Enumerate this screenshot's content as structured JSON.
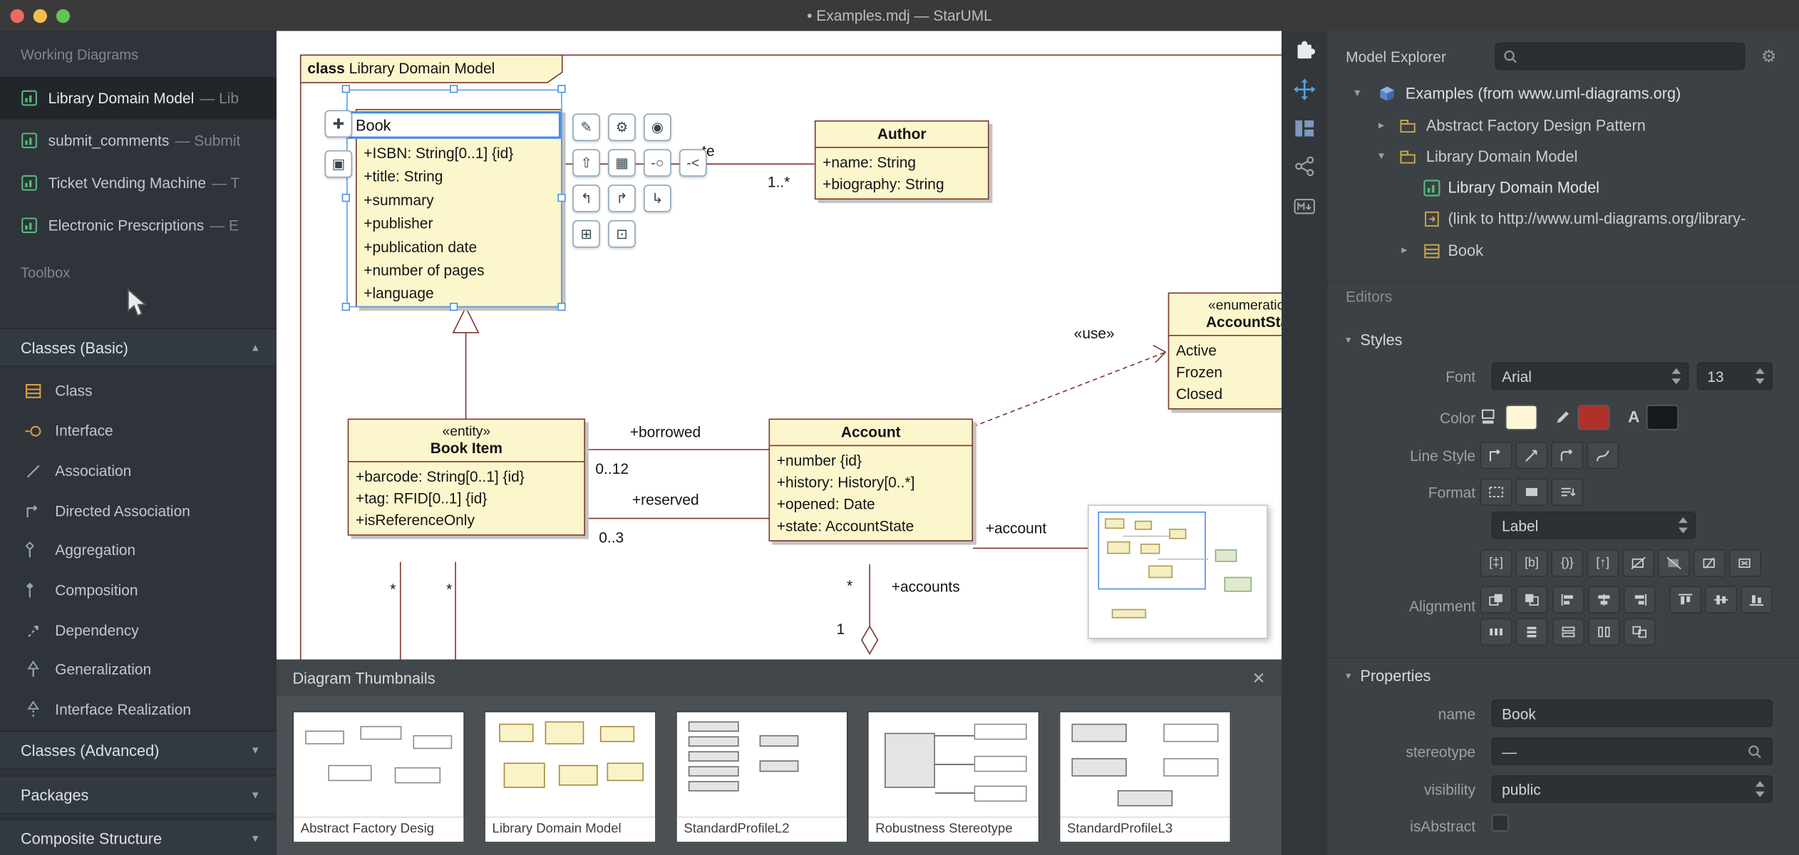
{
  "window": {
    "title": "• Examples.mdj — StarUML"
  },
  "colors": {
    "class_fill": "#FCF6CD",
    "line_maroon": "#7E352B",
    "selection_blue": "#4A90E2",
    "accent_blue": "#4FA3E3",
    "fill_swatch": "#FDF7D8",
    "line_swatch": "#B0312A",
    "font_swatch": "#17191B"
  },
  "sidebar": {
    "working_diagrams_header": "Working Diagrams",
    "diagrams": [
      {
        "name": "Library Domain Model",
        "suffix": "— Lib"
      },
      {
        "name": "submit_comments",
        "suffix": "— Submit"
      },
      {
        "name": "Ticket Vending Machine",
        "suffix": "— T"
      },
      {
        "name": "Electronic Prescriptions",
        "suffix": "— E"
      }
    ],
    "toolbox_header": "Toolbox",
    "sections": [
      {
        "label": "Classes (Basic)",
        "arrow": "▲"
      },
      {
        "label": "Classes (Advanced)",
        "arrow": "▼"
      },
      {
        "label": "Packages",
        "arrow": "▼"
      },
      {
        "label": "Composite Structure",
        "arrow": "▼"
      }
    ],
    "tools": [
      {
        "label": "Class"
      },
      {
        "label": "Interface"
      },
      {
        "label": "Association"
      },
      {
        "label": "Directed Association"
      },
      {
        "label": "Aggregation"
      },
      {
        "label": "Composition"
      },
      {
        "label": "Dependency"
      },
      {
        "label": "Generalization"
      },
      {
        "label": "Interface Realization"
      }
    ]
  },
  "diagram": {
    "frame": {
      "keyword": "class",
      "title": "Library Domain Model"
    },
    "book": {
      "name": "Book",
      "attributes": [
        "+ISBN: String[0..1] {id}",
        "+title: String",
        "+summary",
        "+publisher",
        "+publication date",
        "+number of pages",
        "+language"
      ]
    },
    "author": {
      "name": "Author",
      "attributes": [
        "+name: String",
        "+biography: String"
      ]
    },
    "book_item": {
      "stereotype": "«entity»",
      "name": "Book Item",
      "attributes": [
        "+barcode: String[0..1] {id}",
        "+tag: RFID[0..1] {id}",
        "+isReferenceOnly"
      ]
    },
    "account": {
      "name": "Account",
      "attributes": [
        "+number {id}",
        "+history: History[0..*]",
        "+opened: Date",
        "+state: AccountState"
      ]
    },
    "account_state": {
      "stereotype": "«enumeration»",
      "name": "AccountState",
      "literals": [
        "Active",
        "Frozen",
        "Closed"
      ]
    },
    "labels": {
      "partial": "te",
      "author_mult": "1..*",
      "borrowed": "+borrowed",
      "borrowed_mult": "0..12",
      "reserved": "+reserved",
      "reserved_mult": "0..3",
      "account_role": "+account",
      "accounts_role": "+accounts",
      "item_mult_1": "*",
      "item_mult_2": "*",
      "accounts_mult": "*",
      "account_mult_one": "1",
      "use": "«use»"
    }
  },
  "thumbnails": {
    "title": "Diagram Thumbnails",
    "close": "✕",
    "items": [
      {
        "caption": "Abstract Factory Desig"
      },
      {
        "caption": "Library Domain Model"
      },
      {
        "caption": "StandardProfileL2"
      },
      {
        "caption": "Robustness Stereotype"
      },
      {
        "caption": "StandardProfileL3"
      }
    ]
  },
  "right_toolbar": {
    "icons": [
      "extensions",
      "move",
      "layout",
      "share",
      "markdown"
    ]
  },
  "explorer": {
    "title": "Model Explorer",
    "tree": [
      {
        "label": "Examples (from www.uml-diagrams.org)",
        "arrow": "▾",
        "icon": "model"
      },
      {
        "label": "Abstract Factory Design Pattern",
        "arrow": "▸",
        "icon": "package"
      },
      {
        "label": "Library Domain Model",
        "arrow": "▾",
        "icon": "package"
      },
      {
        "label": "Library Domain Model",
        "arrow": "",
        "icon": "diagram"
      },
      {
        "label": "(link to http://www.uml-diagrams.org/library-",
        "arrow": "",
        "icon": "link"
      },
      {
        "label": "Book",
        "arrow": "▸",
        "icon": "class"
      }
    ]
  },
  "editors": {
    "header": "Editors",
    "styles": {
      "header": "Styles",
      "arrow": "▾",
      "font_label": "Font",
      "font_family": "Arial",
      "font_size": "13",
      "color_label": "Color",
      "line_style_label": "Line Style",
      "format_label": "Format",
      "stereotype_display": "Label",
      "alignment_label": "Alignment",
      "font_color_letter": "A"
    },
    "properties": {
      "header": "Properties",
      "arrow": "▾",
      "name_label": "name",
      "name_value": "Book",
      "stereotype_label": "stereotype",
      "stereotype_value": "—",
      "visibility_label": "visibility",
      "visibility_value": "public",
      "isabstract_label": "isAbstract",
      "isabstract_checked": false
    }
  },
  "icons": {
    "gear": "⚙",
    "palette": {
      "left1": "✚",
      "left2": "▣",
      "b1": "✎",
      "b2": "⚙",
      "b3": "◉",
      "b4": "⇧",
      "b5": "▦",
      "b6": "-○",
      "b7": "-<",
      "b8": "↰",
      "b9": "↱",
      "b10": "↳",
      "b11": "⊞",
      "b12": "⊡"
    },
    "toggles": {
      "t1": "[‡]",
      "t2": "[b]",
      "t3": "{)}",
      "t4": "[↑]"
    }
  }
}
